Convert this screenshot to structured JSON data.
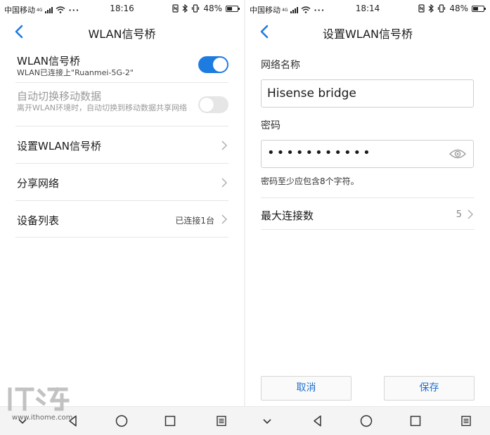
{
  "left": {
    "status": {
      "carrier": "中国移动",
      "network": "4G",
      "time": "18:16",
      "battery": "48%"
    },
    "title": "WLAN信号桥",
    "rows": [
      {
        "label": "WLAN信号桥",
        "sub": "WLAN已连接上\"Ruanmei-5G-2\"",
        "toggle": true
      },
      {
        "label": "自动切换移动数据",
        "sub": "离开WLAN环境时，自动切换到移动数据共享网络",
        "toggle": false,
        "disabled": true
      },
      {
        "label": "设置WLAN信号桥"
      },
      {
        "label": "分享网络"
      },
      {
        "label": "设备列表",
        "value": "已连接1台"
      }
    ]
  },
  "right": {
    "status": {
      "carrier": "中国移动",
      "network": "4G",
      "time": "18:14",
      "battery": "48%"
    },
    "title": "设置WLAN信号桥",
    "network_name_label": "网络名称",
    "network_name_value": "Hisense bridge",
    "password_label": "密码",
    "password_value": "•••••••••••",
    "password_hint": "密码至少应包含8个字符。",
    "max_connections_label": "最大连接数",
    "max_connections_value": "5",
    "cancel_label": "取消",
    "save_label": "保存"
  },
  "battery_level": 0.48,
  "watermark": {
    "text": "IT之家",
    "url": "www.ithome.com"
  },
  "colors": {
    "accent": "#1e7be0",
    "button_text": "#1e6fd0"
  },
  "icons": [
    "back-arrow-icon",
    "chevron-right-icon",
    "eye-icon",
    "wifi-icon",
    "bluetooth-icon",
    "vibrate-icon",
    "battery-icon",
    "nav-back-icon",
    "nav-home-icon",
    "nav-recents-icon",
    "nav-menu-icon",
    "nav-down-icon"
  ]
}
